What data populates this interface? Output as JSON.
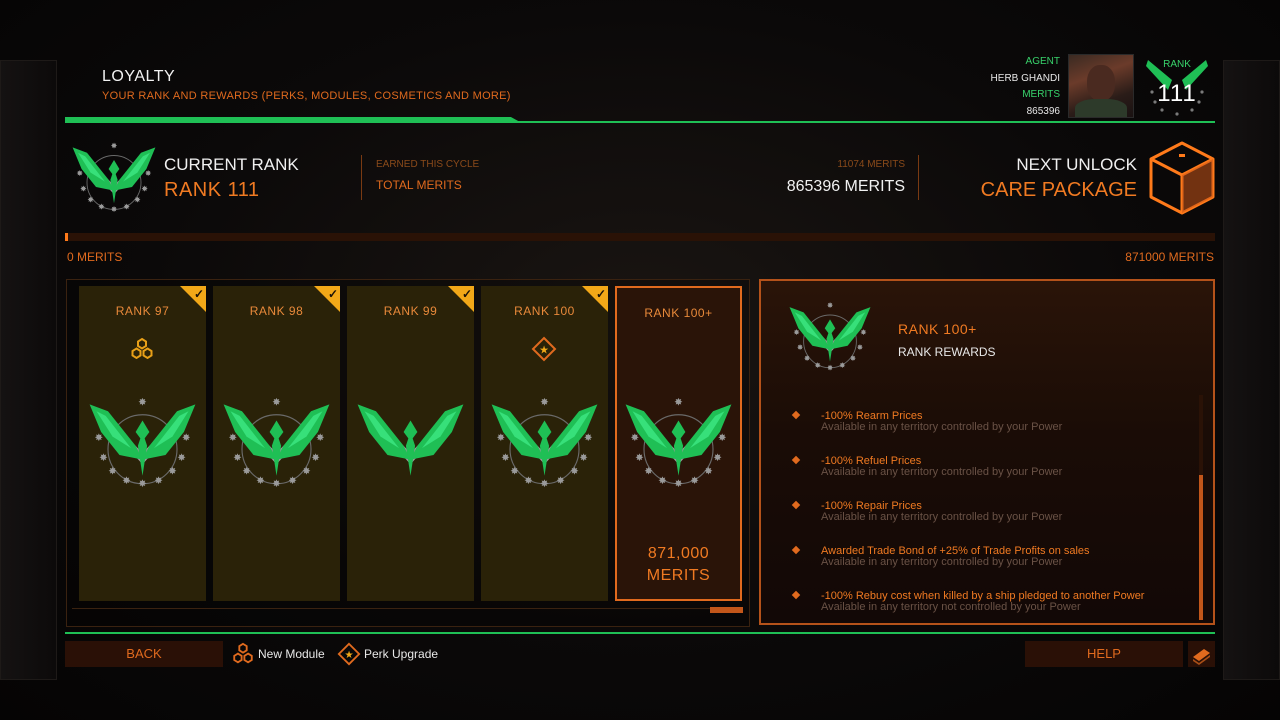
{
  "header": {
    "title": "LOYALTY",
    "subtitle": "YOUR RANK AND REWARDS (PERKS, MODULES, COSMETICS AND MORE)"
  },
  "agent": {
    "agent_label": "AGENT",
    "name": "HERB GHANDI",
    "merits_label": "MERITS",
    "merits_value": "865396",
    "rank_label": "RANK",
    "rank_number": "111"
  },
  "current_rank": {
    "label": "CURRENT RANK",
    "value": "RANK 111"
  },
  "merits_summary": {
    "earned_label": "EARNED THIS CYCLE",
    "earned_value": "11074 MERITS",
    "total_label": "TOTAL MERITS",
    "total_value": "865396 MERITS"
  },
  "next_unlock": {
    "label": "NEXT UNLOCK",
    "value": "CARE PACKAGE"
  },
  "progress": {
    "min_label": "0 MERITS",
    "max_label": "871000 MERITS",
    "fraction": 0.003
  },
  "rank_cards": [
    {
      "title": "RANK 97",
      "icon": "new-module",
      "completed": true,
      "selected": false,
      "merits": ""
    },
    {
      "title": "RANK 98",
      "icon": "",
      "completed": true,
      "selected": false,
      "merits": ""
    },
    {
      "title": "RANK 99",
      "icon": "",
      "completed": true,
      "selected": false,
      "merits": ""
    },
    {
      "title": "RANK 100",
      "icon": "perk-upgrade",
      "completed": true,
      "selected": false,
      "merits": ""
    },
    {
      "title": "RANK 100+",
      "icon": "",
      "completed": false,
      "selected": true,
      "merits_line1": "871,000",
      "merits_line2": "MERITS"
    }
  ],
  "detail": {
    "title": "RANK 100+",
    "subtitle": "RANK REWARDS",
    "perks": [
      {
        "title": "-100% Rearm Prices",
        "desc": "Available in any territory controlled by your Power"
      },
      {
        "title": "-100% Refuel Prices",
        "desc": "Available in any territory controlled by your Power"
      },
      {
        "title": "-100% Repair Prices",
        "desc": "Available in any territory controlled by your Power"
      },
      {
        "title": "Awarded Trade Bond of +25% of Trade Profits on sales",
        "desc": "Available in any territory controlled by your Power"
      },
      {
        "title": "-100% Rebuy cost when killed by a ship pledged to another Power",
        "desc": "Available in any territory not controlled by your Power"
      }
    ]
  },
  "footer": {
    "back_label": "BACK",
    "new_module_label": "New Module",
    "perk_upgrade_label": "Perk Upgrade",
    "help_label": "HELP"
  },
  "colors": {
    "accent_orange": "#e06a1e",
    "accent_green": "#1fbf55",
    "card_bg": "#2a2208",
    "check_gold": "#f2a818"
  }
}
